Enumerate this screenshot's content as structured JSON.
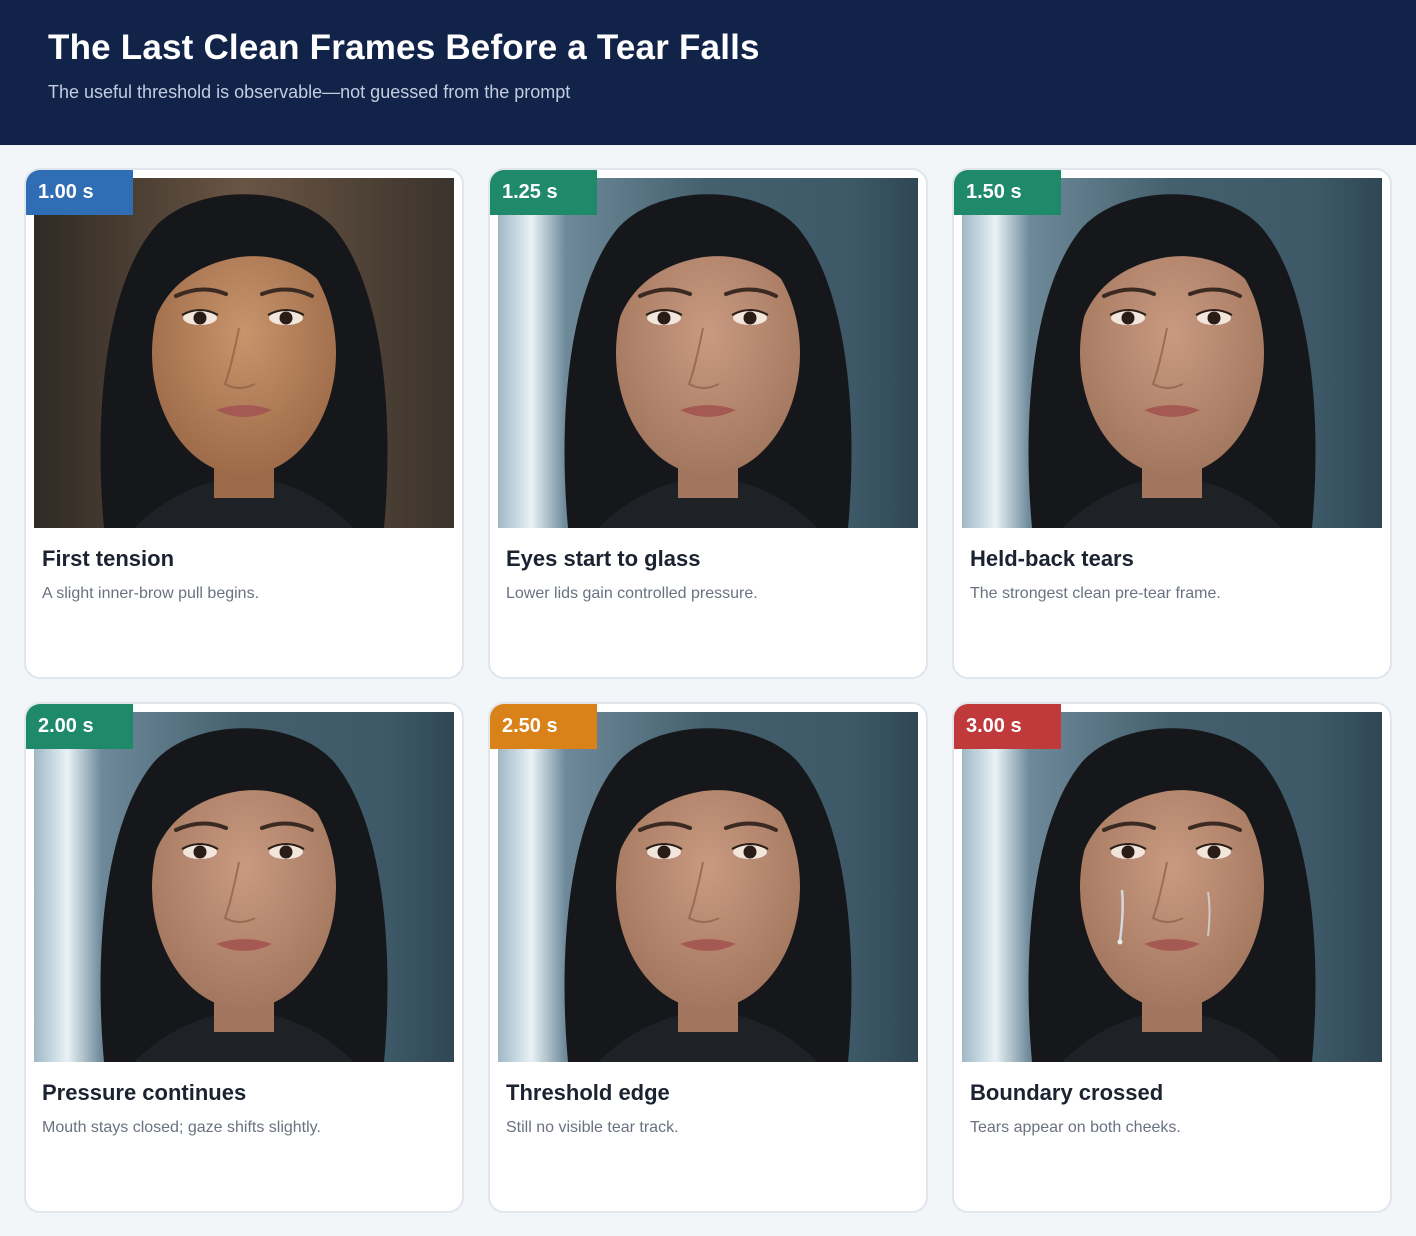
{
  "header": {
    "title": "The Last Clean Frames Before a Tear Falls",
    "subtitle": "The useful threshold is observable—not guessed from the prompt"
  },
  "cards": [
    {
      "time": "1.00 s",
      "badge_color": "#2f6db4",
      "title": "First tension",
      "description": "A slight inner-brow pull begins.",
      "background": "warm-brown",
      "tears": false
    },
    {
      "time": "1.25 s",
      "badge_color": "#1f8a6a",
      "title": "Eyes start to glass",
      "description": "Lower lids gain controlled pressure.",
      "background": "blue-window",
      "tears": false
    },
    {
      "time": "1.50 s",
      "badge_color": "#1f8a6a",
      "title": "Held-back tears",
      "description": "The strongest clean pre-tear frame.",
      "background": "blue-window",
      "tears": false
    },
    {
      "time": "2.00 s",
      "badge_color": "#1f8a6a",
      "title": "Pressure continues",
      "description": "Mouth stays closed; gaze shifts slightly.",
      "background": "blue-window",
      "tears": false
    },
    {
      "time": "2.50 s",
      "badge_color": "#d98219",
      "title": "Threshold edge",
      "description": "Still no visible tear track.",
      "background": "blue-window",
      "tears": false
    },
    {
      "time": "3.00 s",
      "badge_color": "#c0393b",
      "title": "Boundary crossed",
      "description": "Tears appear on both cheeks.",
      "background": "blue-window",
      "tears": true
    }
  ]
}
